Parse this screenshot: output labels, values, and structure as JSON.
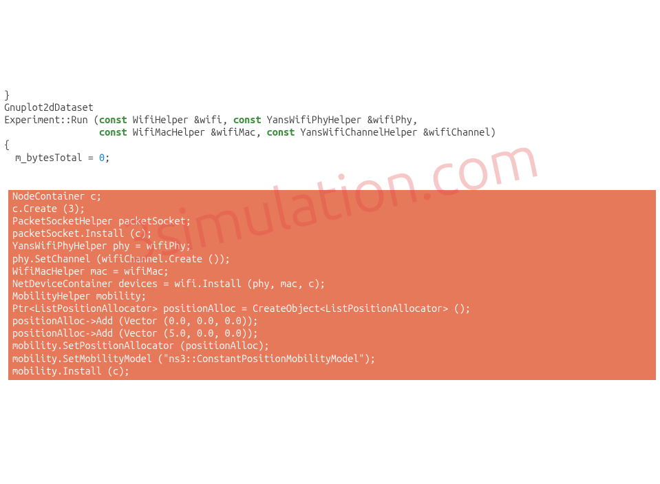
{
  "watermark": "3simulation.com",
  "code": {
    "line01": "}",
    "line02": "Gnuplot2dDataset",
    "line03_pre": "Experiment::Run (",
    "line03_const1": "const",
    "line03_mid1": " WifiHelper &wifi, ",
    "line03_const2": "const",
    "line03_mid2": " YansWifiPhyHelper &wifiPhy,",
    "line04_pre": "                 ",
    "line04_const1": "const",
    "line04_mid1": " WifiMacHelper &wifiMac, ",
    "line04_const2": "const",
    "line04_mid2": " YansWifiChannelHelper &wifiChannel)",
    "line05": "{",
    "line06_pre": "  m_bytesTotal = ",
    "line06_num": "0",
    "line06_post": ";"
  },
  "highlighted": {
    "l01": "NodeContainer c;",
    "l02": "c.Create (3);",
    "l03": "",
    "l04": "PacketSocketHelper packetSocket;",
    "l05": "packetSocket.Install (c);",
    "l06": "",
    "l07": "YansWifiPhyHelper phy = wifiPhy;",
    "l08": "phy.SetChannel (wifiChannel.Create ());",
    "l09": "",
    "l10": "WifiMacHelper mac = wifiMac;",
    "l11": "NetDeviceContainer devices = wifi.Install (phy, mac, c);",
    "l12": "",
    "l13": "MobilityHelper mobility;",
    "l14": "Ptr<ListPositionAllocator> positionAlloc = CreateObject<ListPositionAllocator> ();",
    "l15": "positionAlloc->Add (Vector (0.0, 0.0, 0.0));",
    "l16": "positionAlloc->Add (Vector (5.0, 0.0, 0.0));",
    "l17": "mobility.SetPositionAllocator (positionAlloc);",
    "l18": "mobility.SetMobilityModel (\"ns3::ConstantPositionMobilityModel\");",
    "l19": "",
    "l20": "mobility.Install (c);",
    "l21": ""
  }
}
